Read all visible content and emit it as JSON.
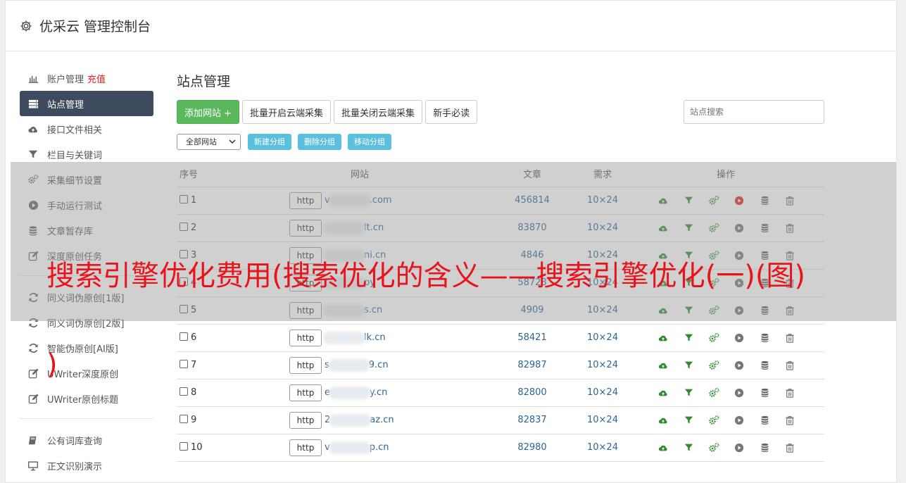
{
  "app": {
    "title": "优采云 管理控制台"
  },
  "sidebar": {
    "items": [
      {
        "label": "账户管理",
        "extra": "充值",
        "icon": "bar-chart-icon"
      },
      {
        "label": "站点管理",
        "icon": "server-icon",
        "active": true
      },
      {
        "label": "接口文件相关",
        "icon": "cloud-upload-icon"
      },
      {
        "label": "栏目与关键词",
        "icon": "filter-icon"
      },
      {
        "label": "采集细节设置",
        "icon": "gears-icon"
      },
      {
        "label": "手动运行测试",
        "icon": "play-circle-icon"
      },
      {
        "label": "文章暂存库",
        "icon": "database-icon"
      },
      {
        "label": "深度原创任务",
        "icon": "edit-icon"
      },
      {
        "label": "同义词伪原创[1版]",
        "icon": "refresh-icon"
      },
      {
        "label": "同义词伪原创[2版]",
        "icon": "refresh-icon"
      },
      {
        "label": "智能伪原创[AI版]",
        "icon": "refresh-icon"
      },
      {
        "label": "UWriter深度原创",
        "icon": "edit-icon"
      },
      {
        "label": "UWriter原创标题",
        "icon": "edit-icon"
      },
      {
        "label": "公有词库查询",
        "icon": "book-icon"
      },
      {
        "label": "正文识别演示",
        "icon": "monitor-icon"
      }
    ]
  },
  "main": {
    "title": "站点管理",
    "toolbar": {
      "add_site": "添加网站 +",
      "batch_open": "批量开启云端采集",
      "batch_close": "批量关闭云端采集",
      "guide": "新手必读",
      "search_placeholder": "站点搜索"
    },
    "toolbar2": {
      "filter_value": "全部网站",
      "new_group": "新建分组",
      "delete_group": "删除分组",
      "move_group": "移动分组"
    },
    "table": {
      "headers": {
        "no": "序号",
        "site": "网站",
        "articles": "文章",
        "demand": "需求",
        "ops": "操作"
      },
      "rows": [
        {
          "no": "1",
          "prefix": "v",
          "suffix": ".com",
          "articles": "456814",
          "demand": "10×24",
          "active": true
        },
        {
          "no": "2",
          "prefix": "",
          "suffix": "lt.cn",
          "articles": "83870",
          "demand": "10×24",
          "active": false
        },
        {
          "no": "3",
          "prefix": "",
          "suffix": "ni.cn",
          "articles": "4846",
          "demand": "10×24",
          "active": false
        },
        {
          "no": "4",
          "prefix": "",
          "suffix": "py",
          "articles": "58728",
          "demand": "10×24",
          "active": false
        },
        {
          "no": "5",
          "prefix": "",
          "suffix": "s.cn",
          "articles": "4909",
          "demand": "10×24",
          "active": false
        },
        {
          "no": "6",
          "prefix": "",
          "suffix": "lk.cn",
          "articles": "58421",
          "demand": "10×24",
          "active": false
        },
        {
          "no": "7",
          "prefix": "s",
          "suffix": "9.cn",
          "articles": "82987",
          "demand": "10×24",
          "active": false
        },
        {
          "no": "8",
          "prefix": "e",
          "suffix": "y.cn",
          "articles": "82800",
          "demand": "10×24",
          "active": false
        },
        {
          "no": "9",
          "prefix": "2",
          "suffix": "az.cn",
          "articles": "82837",
          "demand": "10×24",
          "active": false
        },
        {
          "no": "10",
          "prefix": "v",
          "suffix": "p.cn",
          "articles": "82980",
          "demand": "10×24",
          "active": false
        }
      ],
      "http_label": "http"
    }
  },
  "overlay": {
    "line1": "搜索引擎优化费用(搜索优化的含义——搜索引擎优化(一)(图)",
    "line2": ")"
  },
  "colors": {
    "green": "#5cb85c",
    "info": "#5bc0de",
    "dark": "#3e4a5e",
    "red": "#e8141c",
    "link": "#2a6496"
  }
}
